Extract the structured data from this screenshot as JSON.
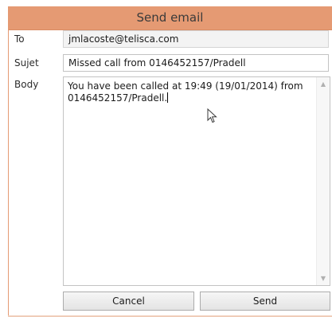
{
  "window": {
    "title": "Send email"
  },
  "form": {
    "to_label": "To",
    "to_value": "jmlacoste@telisca.com",
    "subject_label": "Sujet",
    "subject_value": "Missed call from  0146452157/Pradell",
    "body_label": "Body",
    "body_value": "You have been called at 19:49 (19/01/2014) from\n0146452157/Pradell."
  },
  "buttons": {
    "cancel_label": "Cancel",
    "send_label": "Send"
  },
  "icons": {
    "scroll_up": "chevron-up-icon",
    "scroll_down": "chevron-down-icon",
    "pointer": "mouse-pointer-icon"
  },
  "colors": {
    "titlebar": "#e59a73"
  }
}
